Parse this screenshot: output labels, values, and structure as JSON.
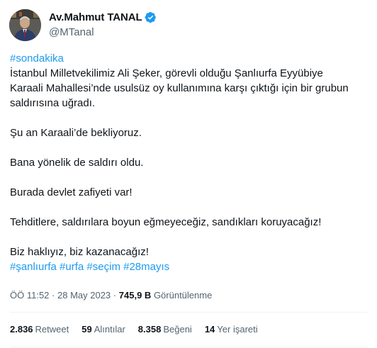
{
  "author": {
    "display_name": "Av.Mahmut TANAL",
    "handle": "@MTanal",
    "verified_icon": "verified-badge-icon",
    "verified_color": "#1d9bf0"
  },
  "tweet": {
    "hashtag_top": "#sondakika",
    "lines": [
      "İstanbul Milletvekilimiz Ali Şeker, görevli olduğu Şanlıurfa Eyyübiye",
      "Karaali Mahallesi’nde usulsüz oy kullanımına karşı çıktığı için bir grubun",
      "saldırısına uğradı."
    ],
    "p2": "Şu an Karaali’de bekliyoruz.",
    "p3": "Bana yönelik de saldırı oldu.",
    "p4": "Burada devlet zafiyeti var!",
    "p5": "Tehditlere, saldırılara boyun eğmeyeceğiz, sandıkları koruyacağız!",
    "p6": "Biz haklıyız, biz kazanacağız!",
    "hashtags": [
      "#şanlıurfa",
      "#urfa",
      "#seçim",
      "#28mayıs"
    ]
  },
  "meta": {
    "time": "ÖÖ 11:52",
    "separator": "·",
    "date": "28 May 2023",
    "views_count": "745,9 B",
    "views_label": "Görüntülenme"
  },
  "stats": {
    "retweets_count": "2.836",
    "retweets_label": "Retweet",
    "quotes_count": "59",
    "quotes_label": "Alıntılar",
    "likes_count": "8.358",
    "likes_label": "Beğeni",
    "bookmarks_count": "14",
    "bookmarks_label": "Yer işareti"
  },
  "colors": {
    "accent": "#1d9bf0",
    "text": "#0f1419",
    "secondary": "#536471",
    "divider": "#eff3f4"
  }
}
